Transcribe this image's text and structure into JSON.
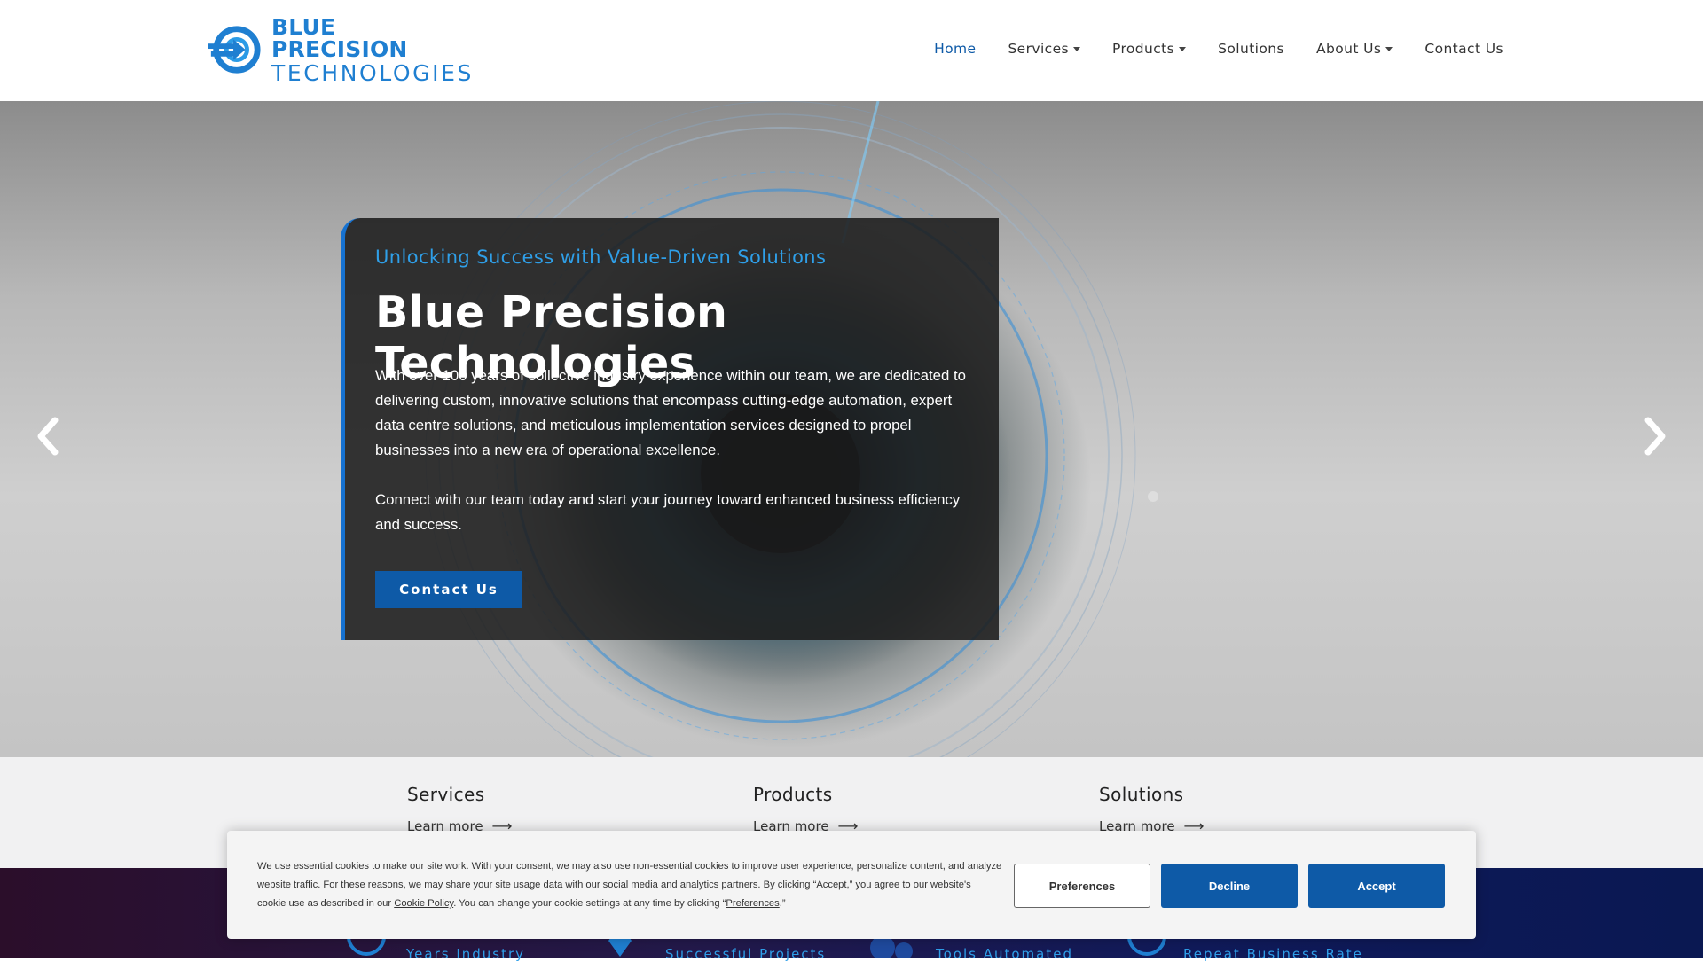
{
  "logo": {
    "line1": "BLUE PRECISION",
    "line2": "TECHNOLOGIES"
  },
  "nav": {
    "items": [
      {
        "label": "Home",
        "active": true,
        "dropdown": false
      },
      {
        "label": "Services",
        "active": false,
        "dropdown": true
      },
      {
        "label": "Products",
        "active": false,
        "dropdown": true
      },
      {
        "label": "Solutions",
        "active": false,
        "dropdown": false
      },
      {
        "label": "About Us",
        "active": false,
        "dropdown": true
      },
      {
        "label": "Contact Us",
        "active": false,
        "dropdown": false
      }
    ]
  },
  "hero": {
    "subtitle": "Unlocking Success with Value-Driven Solutions",
    "title": "Blue Precision Technologies",
    "paragraph1": "With over 100 years of collective industry experience within our team, we are dedicated to delivering custom, innovative solutions that encompass cutting-edge automation, expert data centre solutions, and meticulous implementation services designed to propel businesses into a new era of operational excellence.",
    "paragraph2": "Connect with our team today and start your journey toward enhanced business efficiency and success.",
    "cta_label": "Contact Us"
  },
  "features": [
    {
      "title": "Services",
      "link": "Learn more"
    },
    {
      "title": "Products",
      "link": "Learn more"
    },
    {
      "title": "Solutions",
      "link": "Learn more"
    }
  ],
  "stats": [
    {
      "label": "Years Industry"
    },
    {
      "label": "Successful Projects"
    },
    {
      "label": "Tools Automated"
    },
    {
      "label": "Repeat Business Rate"
    }
  ],
  "cookie": {
    "text_before": "We use essential cookies to make our site work. With your consent, we may also use non-essential cookies to improve user experience, personalize content, and analyze website traffic. For these reasons, we may share your site usage data with our social media and analytics partners. By clicking “Accept,” you agree to our website's cookie use as described in our ",
    "policy_link": "Cookie Policy",
    "text_middle": ". You can change your cookie settings at any time by clicking “",
    "pref_link": "Preferences",
    "text_after": ".”",
    "buttons": {
      "preferences": "Preferences",
      "decline": "Decline",
      "accept": "Accept"
    }
  },
  "colors": {
    "brand_blue": "#0e5aa7",
    "accent_blue": "#2f9fe8",
    "logo_blue": "#1f7fd1"
  }
}
